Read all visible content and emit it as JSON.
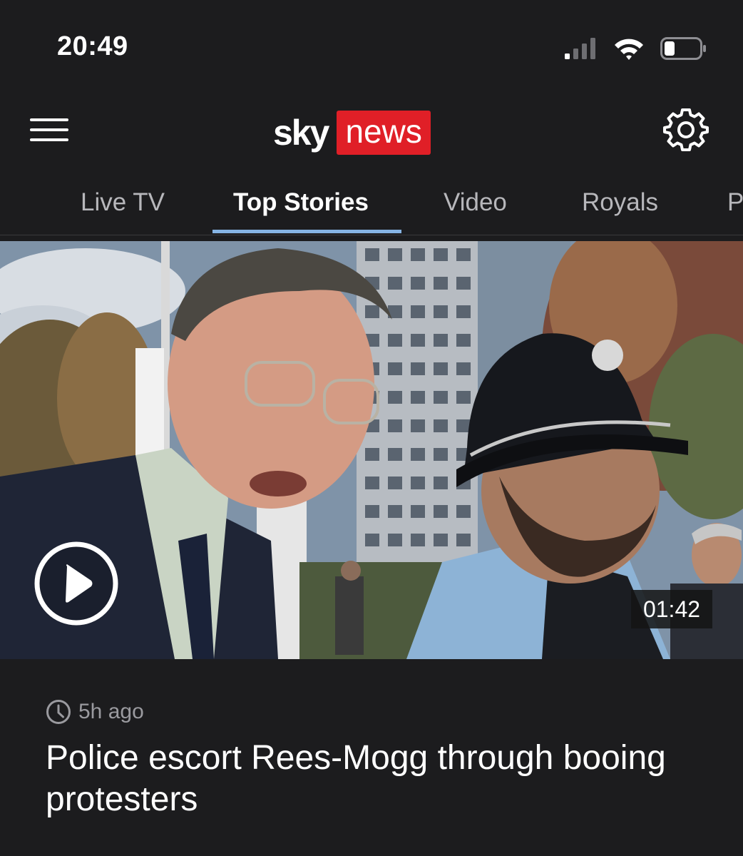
{
  "status_bar": {
    "time": "20:49"
  },
  "header": {
    "logo_sky": "sky",
    "logo_news": "news",
    "brand_color": "#e01f27"
  },
  "tabs": [
    {
      "label": "Live TV",
      "active": false
    },
    {
      "label": "Top Stories",
      "active": true
    },
    {
      "label": "Video",
      "active": false
    },
    {
      "label": "Royals",
      "active": false
    },
    {
      "label": "P",
      "active": false
    }
  ],
  "tab_accent_color": "#86b4e4",
  "video": {
    "duration": "01:42",
    "play_icon": "play-circle-icon"
  },
  "article": {
    "timestamp": "5h ago",
    "timestamp_icon": "clock-icon",
    "headline": "Police escort Rees-Mogg through booing protesters"
  }
}
